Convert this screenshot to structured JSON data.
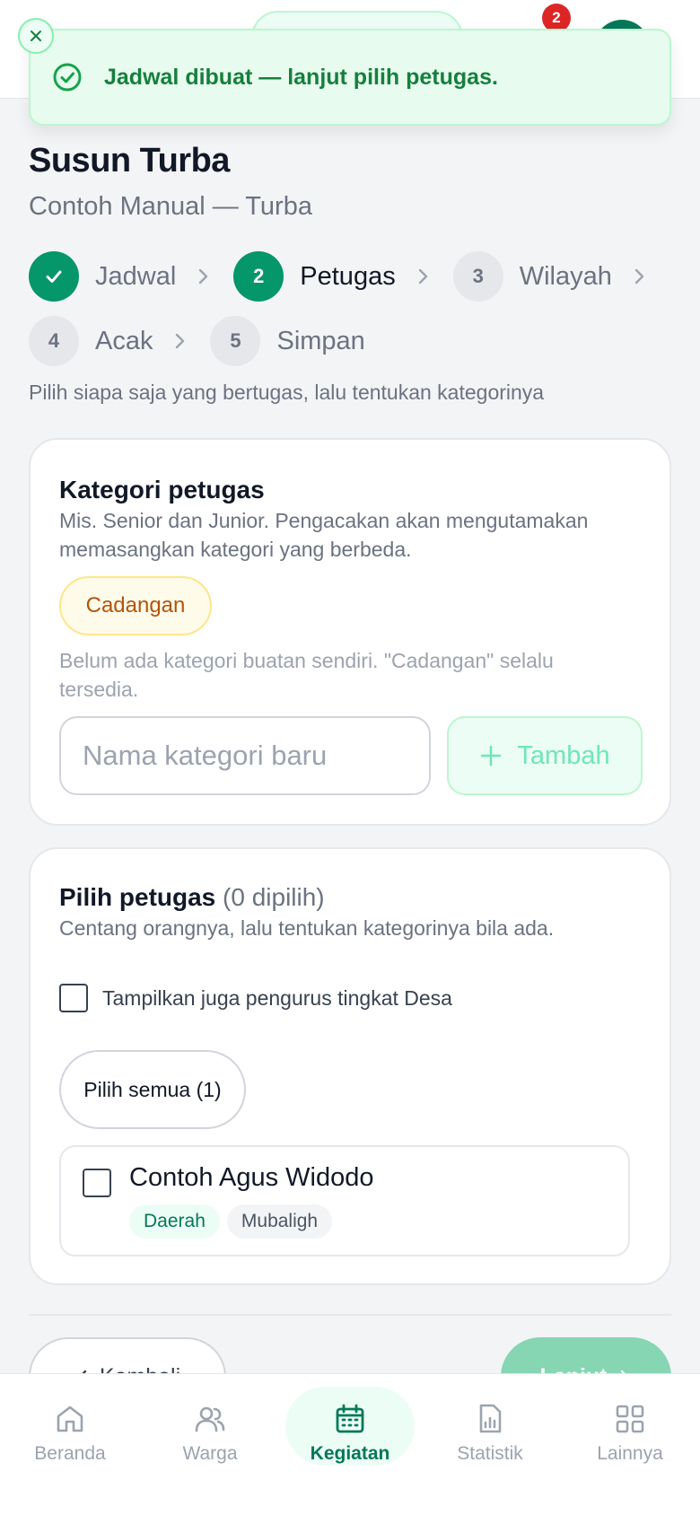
{
  "topbar": {
    "notification_count": "2"
  },
  "toast": {
    "message": "Jadwal dibuat — lanjut pilih petugas."
  },
  "header": {
    "title": "Susun Turba",
    "subtitle": "Contoh Manual — Turba"
  },
  "stepper": {
    "steps": [
      {
        "number": "1",
        "label": "Jadwal",
        "state": "done"
      },
      {
        "number": "2",
        "label": "Petugas",
        "state": "active"
      },
      {
        "number": "3",
        "label": "Wilayah",
        "state": "pending"
      },
      {
        "number": "4",
        "label": "Acak",
        "state": "pending"
      },
      {
        "number": "5",
        "label": "Simpan",
        "state": "pending"
      }
    ],
    "hint": "Pilih siapa saja yang bertugas, lalu tentukan kategorinya"
  },
  "category_card": {
    "title": "Kategori petugas",
    "description": "Mis. Senior dan Junior. Pengacakan akan mengutamakan memasangkan kategori yang berbeda.",
    "reserve_chip": "Cadangan",
    "empty_note": "Belum ada kategori buatan sendiri. \"Cadangan\" selalu tersedia.",
    "input_placeholder": "Nama kategori baru",
    "add_button": "Tambah"
  },
  "officers_card": {
    "title": "Pilih petugas",
    "selected_count": "(0 dipilih)",
    "description": "Centang orangnya, lalu tentukan kategorinya bila ada.",
    "show_village_label": "Tampilkan juga pengurus tingkat Desa",
    "select_all_button": "Pilih semua (1)",
    "people": [
      {
        "name": "Contoh Agus Widodo",
        "tags": [
          "Daerah",
          "Mubaligh"
        ]
      }
    ]
  },
  "footer_actions": {
    "back_label": "Kembali",
    "next_label": "Lanjut"
  },
  "bottom_nav": {
    "items": [
      {
        "label": "Beranda",
        "icon": "home-icon"
      },
      {
        "label": "Warga",
        "icon": "users-icon"
      },
      {
        "label": "Kegiatan",
        "icon": "calendar-icon",
        "active": true
      },
      {
        "label": "Statistik",
        "icon": "chart-icon"
      },
      {
        "label": "Lainnya",
        "icon": "grid-icon"
      }
    ]
  },
  "colors": {
    "primary": "#059669",
    "primary_soft": "#ecfdf5",
    "reserve": "#b45309",
    "badge": "#dc2626"
  }
}
